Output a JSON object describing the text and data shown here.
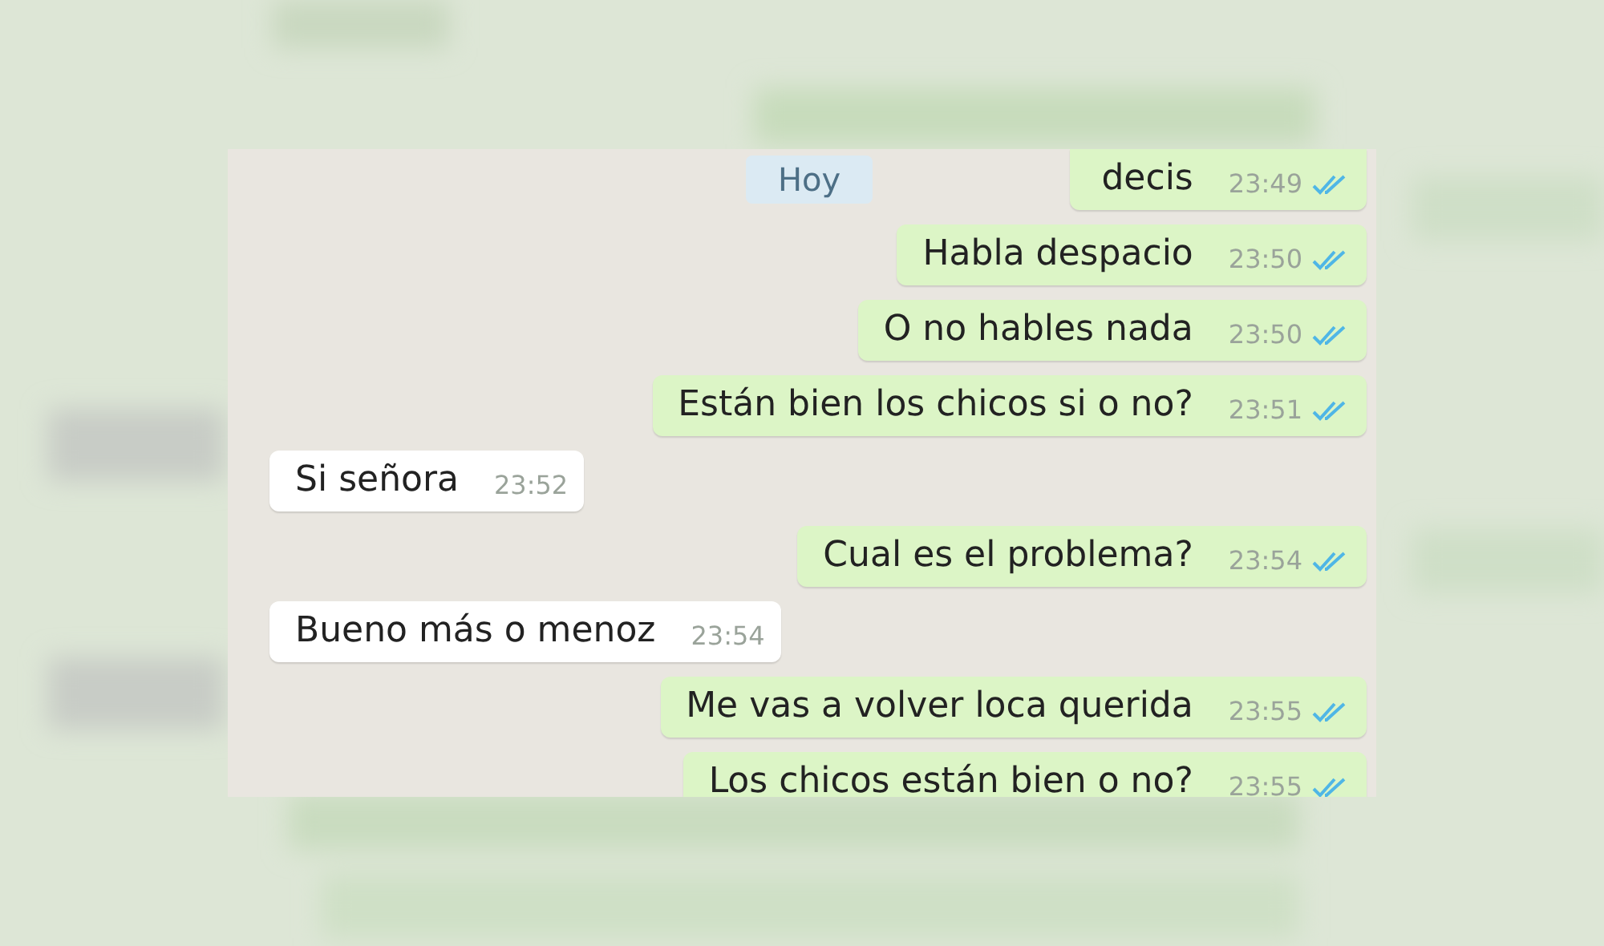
{
  "date_chip": "Hoy",
  "messages": [
    {
      "kind": "outgoing",
      "text": "decis",
      "time": "23:49",
      "read": true
    },
    {
      "kind": "outgoing",
      "text": "Habla despacio",
      "time": "23:50",
      "read": true
    },
    {
      "kind": "outgoing",
      "text": "O no hables nada",
      "time": "23:50",
      "read": true
    },
    {
      "kind": "outgoing",
      "text": "Están bien los chicos si o no?",
      "time": "23:51",
      "read": true
    },
    {
      "kind": "incoming",
      "text": "Si señora",
      "time": "23:52"
    },
    {
      "kind": "outgoing",
      "text": "Cual es el problema?",
      "time": "23:54",
      "read": true
    },
    {
      "kind": "incoming",
      "text": "Bueno más o menoz",
      "time": "23:54"
    },
    {
      "kind": "outgoing",
      "text": "Me vas a volver loca querida",
      "time": "23:55",
      "read": true
    },
    {
      "kind": "outgoing",
      "text": "Los chicos están bien o no?",
      "time": "23:55",
      "read": true
    }
  ]
}
